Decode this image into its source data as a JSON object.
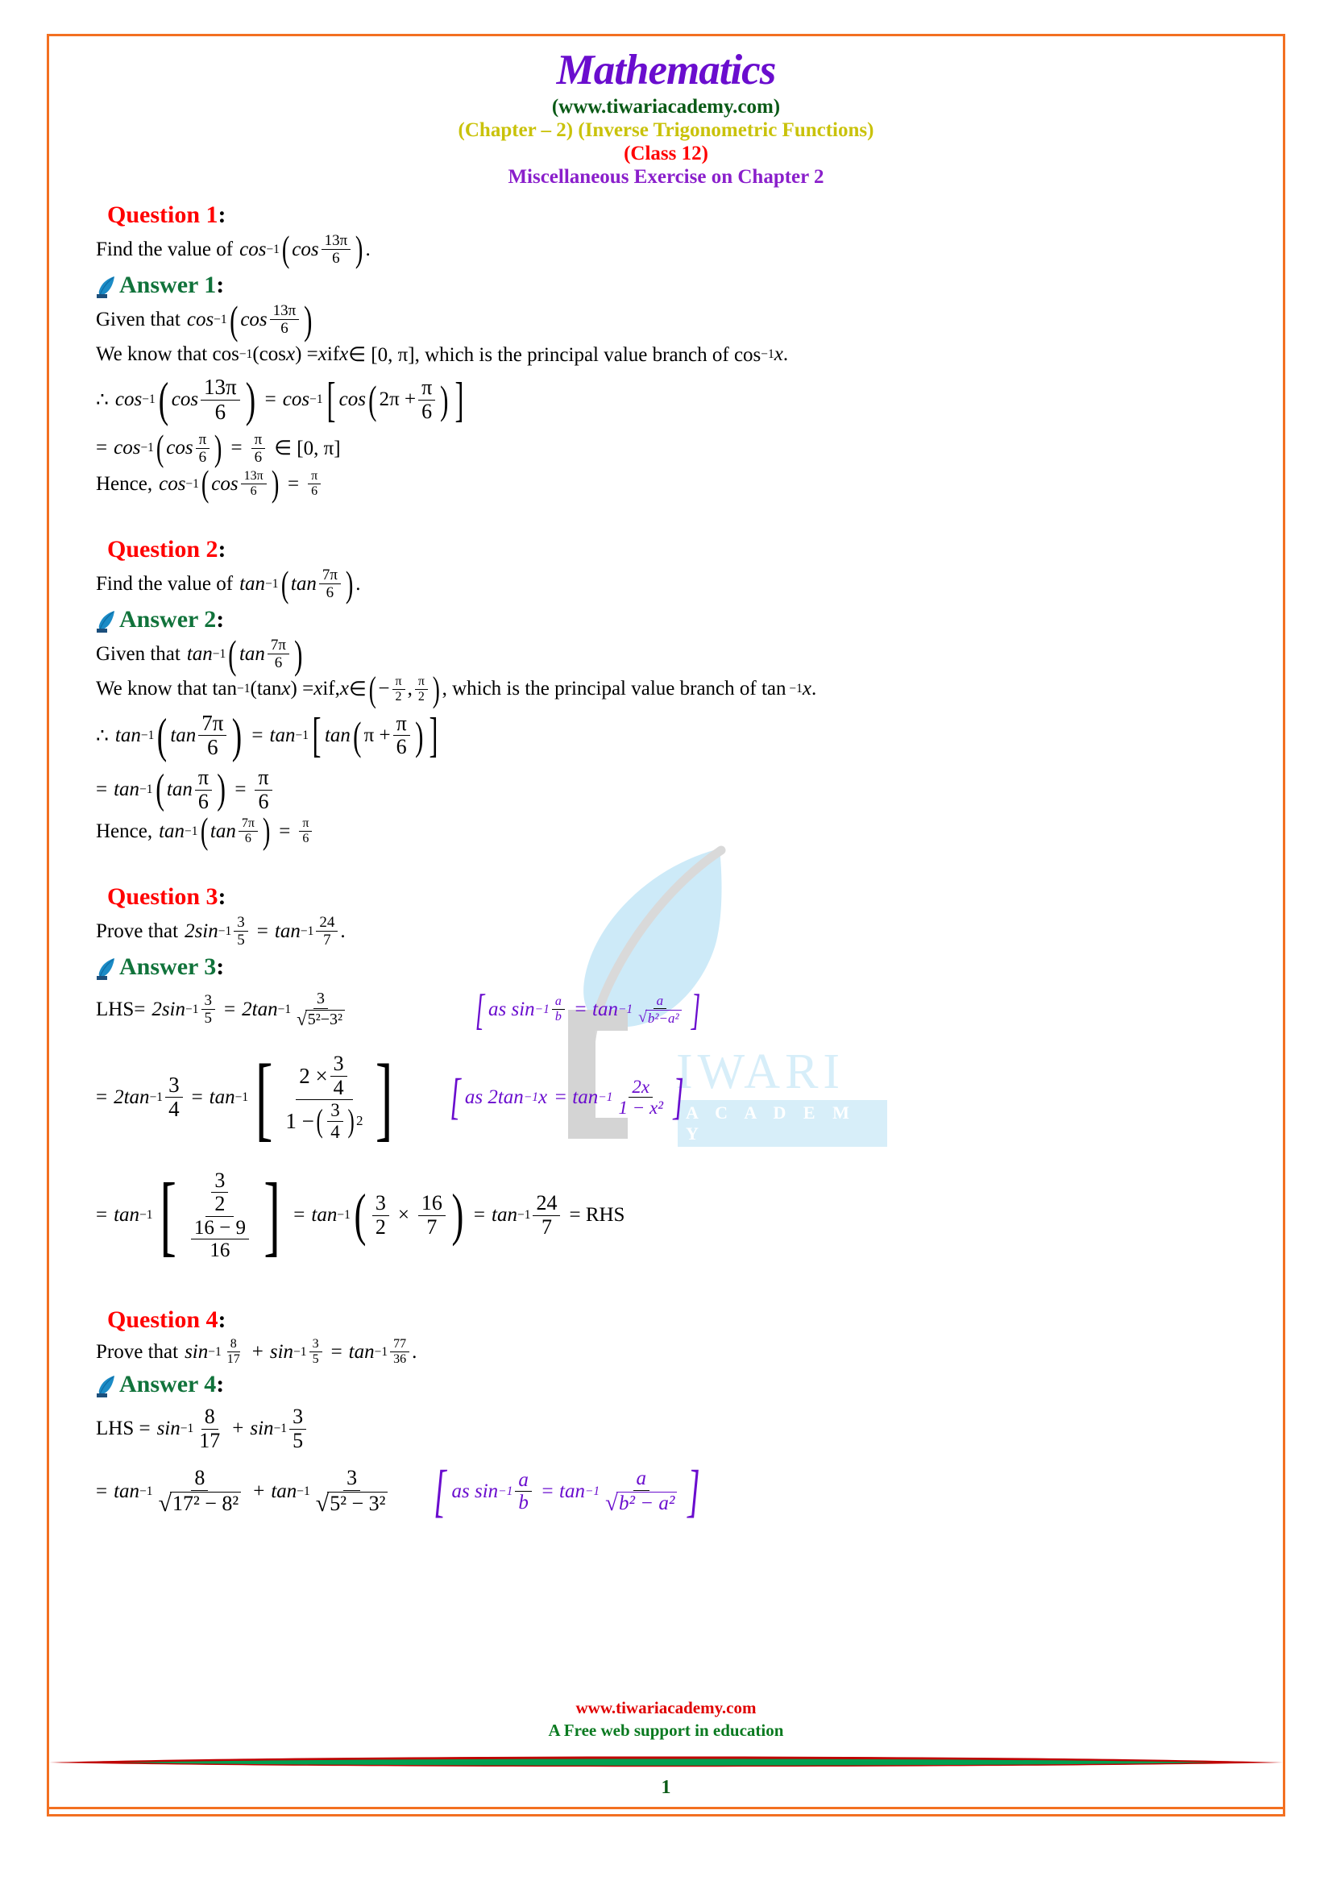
{
  "header": {
    "title": "Mathematics",
    "site": "(www.tiwariacademy.com)",
    "chapter": "(Chapter – 2) (Inverse Trigonometric Functions)",
    "class": "(Class 12)",
    "exercise": "Miscellaneous Exercise on Chapter 2"
  },
  "watermark": {
    "brand_top": "IWARI",
    "brand_bottom": "A C A D E M Y",
    "leaf_color": "#CDEAF8",
    "stem_color": "#D4D4D4"
  },
  "colors": {
    "question": "#FF0000",
    "answer": "#11733B",
    "formula_note": "#6A0DCE",
    "title": "#6A0DCE",
    "site": "#0A5A16",
    "chapter": "#C9C20A",
    "class": "#FF0000",
    "exercise": "#8A1FCB",
    "page_border": "#F37021"
  },
  "q1": {
    "heading": "Question 1",
    "prompt_prefix": "Find the value of",
    "prompt_fn": "cos",
    "prompt_inner_fn": "cos",
    "prompt_num": "13π",
    "prompt_den": "6",
    "answer_heading": "Answer 1",
    "given_label": "Given that",
    "rule_text_a": "We know that cos",
    "rule_text_b": "(cos ",
    "rule_text_c": ") = ",
    "rule_text_d": " if ",
    "rule_text_e": " ∈ [0, π], which is the principal value branch of cos",
    "rule_var": "x",
    "step1_lead": "∴",
    "step1_fn": "cos",
    "step1_num": "13π",
    "step1_den": "6",
    "step1_rhs_inner": "2π +",
    "step1_rhs_num": "π",
    "step1_rhs_den": "6",
    "step2_num": "π",
    "step2_den": "6",
    "step2_set": "∈ [0, π]",
    "hence_label": "Hence,",
    "hence_num": "13π",
    "hence_den": "6",
    "hence_res_num": "π",
    "hence_res_den": "6"
  },
  "q2": {
    "heading": "Question 2",
    "prompt_prefix": "Find the value of",
    "prompt_fn": "tan",
    "prompt_num": "7π",
    "prompt_den": "6",
    "answer_heading": "Answer 2",
    "given_label": "Given that",
    "rule_text_a": "We know that tan",
    "rule_text_b": "(tan ",
    "rule_text_c": ") = ",
    "rule_text_d": " if, ",
    "rule_text_e": " ∈",
    "rule_text_f": ", which is the principal value branch of tan",
    "rule_var": "x",
    "rule_interval_neg": "−",
    "rule_interval_num": "π",
    "rule_interval_den": "2",
    "step1_lead": "∴",
    "step1_fn": "tan",
    "step1_num": "7π",
    "step1_den": "6",
    "step1_rhs_inner": "π +",
    "step1_rhs_num": "π",
    "step1_rhs_den": "6",
    "step2_num": "π",
    "step2_den": "6",
    "hence_label": "Hence,",
    "hence_num": "7π",
    "hence_den": "6",
    "hence_res_num": "π",
    "hence_res_den": "6"
  },
  "q3": {
    "heading": "Question 3",
    "prompt_prefix": "Prove that",
    "prompt_lhs_coeff": "2",
    "prompt_lhs_fn": "sin",
    "prompt_lhs_num": "3",
    "prompt_lhs_den": "5",
    "prompt_rhs_fn": "tan",
    "prompt_rhs_num": "24",
    "prompt_rhs_den": "7",
    "answer_heading": "Answer 3",
    "lhs_label": "LHS=",
    "l1_coeff": "2",
    "l1_fn": "sin",
    "l1_num": "3",
    "l1_den": "5",
    "l1_r_coeff": "2",
    "l1_r_fn": "tan",
    "l1_r_num": "3",
    "l1_r_den_sqrt": "5²−3²",
    "note1": {
      "as": "as sin",
      "a": "a",
      "b": "b",
      "eq": "= tan",
      "rad": "b²−a²"
    },
    "l2_coeff": "2",
    "l2_fn": "tan",
    "l2_num": "3",
    "l2_den": "4",
    "l2_r_fn": "tan",
    "l2_big_num_a": "2 ×",
    "l2_big_num_b_num": "3",
    "l2_big_num_b_den": "4",
    "l2_big_den_a": "1 −",
    "l2_big_den_b_num": "3",
    "l2_big_den_b_den": "4",
    "l2_big_den_pow": "2",
    "note2": {
      "as": "as 2tan",
      "x": "x",
      "eq": "= tan",
      "num": "2x",
      "den": "1 − x²"
    },
    "l3_fn": "tan",
    "l3_top_num": "3",
    "l3_top_den": "2",
    "l3_bot_num": "16 − 9",
    "l3_bot_den": "16",
    "l3_m_fn": "tan",
    "l3_m_a_num": "3",
    "l3_m_a_den": "2",
    "l3_m_times": "×",
    "l3_m_b_num": "16",
    "l3_m_b_den": "7",
    "l3_f_fn": "tan",
    "l3_f_num": "24",
    "l3_f_den": "7",
    "rhs_label": "= RHS"
  },
  "q4": {
    "heading": "Question 4",
    "prompt_prefix": "Prove that",
    "p_a_fn": "sin",
    "p_a_num": "8",
    "p_a_den": "17",
    "p_plus": "+",
    "p_b_fn": "sin",
    "p_b_num": "3",
    "p_b_den": "5",
    "p_eq_fn": "tan",
    "p_eq_num": "77",
    "p_eq_den": "36",
    "answer_heading": "Answer 4",
    "lhs_label": "LHS =",
    "l1_a_fn": "sin",
    "l1_a_num": "8",
    "l1_a_den": "17",
    "l1_b_fn": "sin",
    "l1_b_num": "3",
    "l1_b_den": "5",
    "l2_a_fn": "tan",
    "l2_a_num": "8",
    "l2_a_den_rad": "17² − 8²",
    "l2_b_fn": "tan",
    "l2_b_num": "3",
    "l2_b_den_rad": "5² − 3²",
    "note1": {
      "as": "as sin",
      "a": "a",
      "b": "b",
      "eq": "= tan",
      "rad": "b² − a²"
    }
  },
  "footer": {
    "url": "www.tiwariacademy.com",
    "tagline": "A Free web support in education",
    "page": "1"
  }
}
